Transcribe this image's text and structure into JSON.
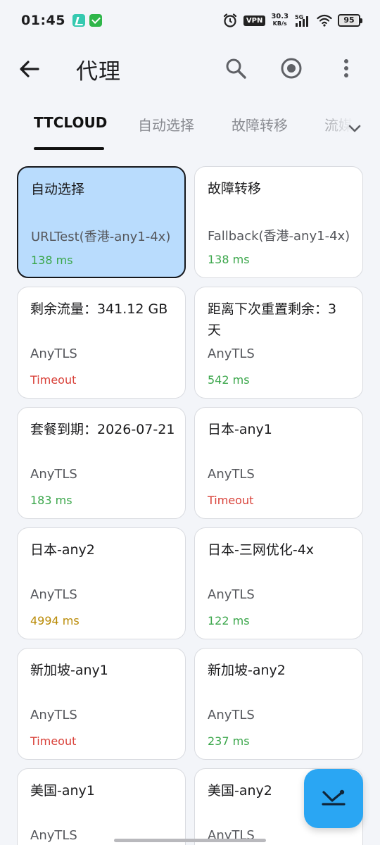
{
  "status_bar": {
    "time": "01:45",
    "vpn_label": "VPN",
    "net_speed_value": "30.3",
    "net_speed_unit": "KB/s",
    "network_type": "5G",
    "battery_level": "95"
  },
  "header": {
    "title": "代理"
  },
  "tabs": [
    {
      "label": "TTCLOUD",
      "active": true
    },
    {
      "label": "自动选择",
      "active": false
    },
    {
      "label": "故障转移",
      "active": false
    },
    {
      "label": "流媒",
      "active": false
    }
  ],
  "proxies": [
    {
      "name": "自动选择",
      "type": "URLTest(香港-any1-4x)",
      "delay": "138 ms",
      "delay_status": "ok",
      "selected": true
    },
    {
      "name": "故障转移",
      "type": "Fallback(香港-any1-4x)",
      "delay": "138 ms",
      "delay_status": "ok",
      "selected": false
    },
    {
      "name": "剩余流量：341.12 GB",
      "type": "AnyTLS",
      "delay": "Timeout",
      "delay_status": "timeout",
      "selected": false
    },
    {
      "name": "距离下次重置剩余：3 天",
      "type": "AnyTLS",
      "delay": "542 ms",
      "delay_status": "ok",
      "selected": false
    },
    {
      "name": "套餐到期：2026-07-21",
      "type": "AnyTLS",
      "delay": "183 ms",
      "delay_status": "ok",
      "selected": false
    },
    {
      "name": "日本-any1",
      "type": "AnyTLS",
      "delay": "Timeout",
      "delay_status": "timeout",
      "selected": false
    },
    {
      "name": "日本-any2",
      "type": "AnyTLS",
      "delay": "4994 ms",
      "delay_status": "slow",
      "selected": false
    },
    {
      "name": "日本-三网优化-4x",
      "type": "AnyTLS",
      "delay": "122 ms",
      "delay_status": "ok",
      "selected": false
    },
    {
      "name": "新加坡-any1",
      "type": "AnyTLS",
      "delay": "Timeout",
      "delay_status": "timeout",
      "selected": false
    },
    {
      "name": "新加坡-any2",
      "type": "AnyTLS",
      "delay": "237 ms",
      "delay_status": "ok",
      "selected": false
    },
    {
      "name": "美国-any1",
      "type": "AnyTLS",
      "delay": "",
      "delay_status": "ok",
      "selected": false
    },
    {
      "name": "美国-any2",
      "type": "AnyTLS",
      "delay": "",
      "delay_status": "ok",
      "selected": false
    }
  ],
  "colors": {
    "delay_ok": "#3aa64a",
    "delay_timeout": "#d9423a",
    "delay_slow": "#b98a05",
    "selected_card": "#b9dcfd",
    "fab": "#2aa6f3"
  },
  "icons": {
    "back": "arrow-left-icon",
    "search": "search-icon",
    "record": "target-icon",
    "more": "more-vertical-icon",
    "tabs_dropdown": "chevron-down-icon",
    "fab": "latency-test-icon"
  }
}
